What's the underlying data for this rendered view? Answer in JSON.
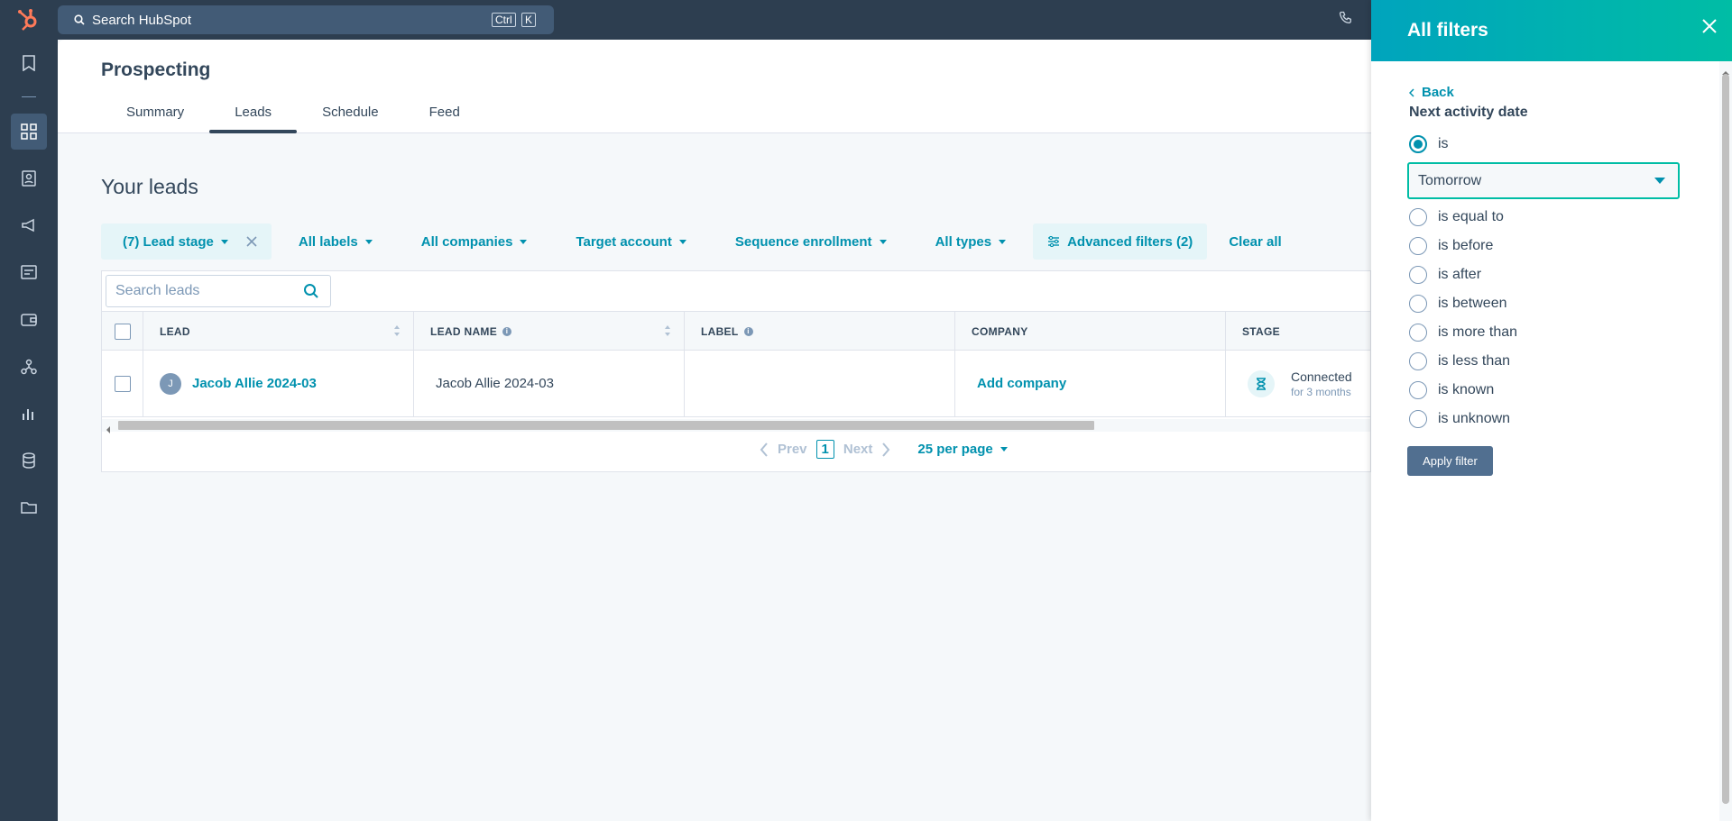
{
  "topbar": {
    "search_placeholder": "Search HubSpot",
    "kbd_ctrl": "Ctrl",
    "kbd_k": "K"
  },
  "page": {
    "title": "Prospecting",
    "tabs": [
      {
        "label": "Summary"
      },
      {
        "label": "Leads"
      },
      {
        "label": "Schedule"
      },
      {
        "label": "Feed"
      }
    ],
    "section_title": "Your leads"
  },
  "filters": {
    "lead_stage": "(7) Lead stage",
    "labels": "All labels",
    "companies": "All companies",
    "target_account": "Target account",
    "sequence": "Sequence enrollment",
    "types": "All types",
    "advanced": "Advanced filters (2)",
    "clear": "Clear all"
  },
  "table": {
    "search_placeholder": "Search leads",
    "headers": {
      "lead": "LEAD",
      "lead_name": "LEAD NAME",
      "label": "LABEL",
      "company": "COMPANY",
      "stage": "STAGE"
    },
    "rows": [
      {
        "avatar": "J",
        "lead": "Jacob Allie 2024-03",
        "lead_name": "Jacob Allie 2024-03",
        "label": "",
        "company": "Add company",
        "stage": "Connected",
        "stage_sub": "for 3 months"
      }
    ]
  },
  "pager": {
    "prev": "Prev",
    "page": "1",
    "next": "Next",
    "per_page": "25 per page"
  },
  "panel": {
    "title": "All filters",
    "back": "Back",
    "filter_label": "Next activity date",
    "selected_option": "is",
    "select_value": "Tomorrow",
    "options": [
      "is",
      "is equal to",
      "is before",
      "is after",
      "is between",
      "is more than",
      "is less than",
      "is known",
      "is unknown"
    ],
    "apply": "Apply filter"
  },
  "colors": {
    "accent": "#0091ae",
    "nav": "#2d3e50",
    "brand": "#ff7a59"
  }
}
